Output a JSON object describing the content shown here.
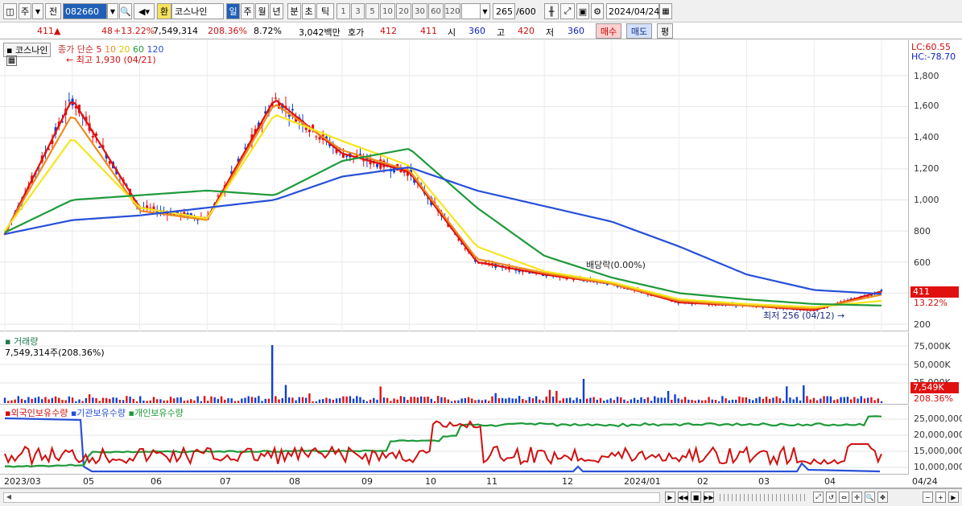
{
  "toolbar": {
    "type1": "주",
    "type2": "전",
    "code": "082660",
    "hwan": "환",
    "name": "코스나인",
    "periods": [
      "일",
      "주",
      "월",
      "년",
      "분",
      "초",
      "틱"
    ],
    "numbers": [
      "1",
      "3",
      "5",
      "10",
      "20",
      "30",
      "60",
      "120"
    ],
    "count": "265",
    "count_total": "/600",
    "date": "2024/04/24"
  },
  "quote": {
    "price": "411",
    "change": "48",
    "pct": "+13.22%",
    "volume": "7,549,314",
    "vol_pct": "208.36%",
    "turnover": "8.72%",
    "amount": "3,042백만",
    "hoga_label": "호가",
    "ask": "412",
    "bid": "411",
    "open_label": "시",
    "open": "360",
    "high_label": "고",
    "high": "420",
    "low_label": "저",
    "low": "360",
    "buy": "매수",
    "sell": "매도",
    "even": "평"
  },
  "price_panel": {
    "name": "코스나인",
    "ma_label": "종가 단순",
    "ma": [
      "5",
      "10",
      "20",
      "60",
      "120"
    ],
    "max_note": "최고 1,930 (04/21)",
    "min_note": "최저 256 (04/12)",
    "dividend_note": "배당락(0.00%)",
    "lc": "LC:60.55",
    "hc": "HC:-78.70",
    "cur_price": "411",
    "cur_pct": "13.22%",
    "yticks": [
      "1,800",
      "1,600",
      "1,400",
      "1,200",
      "1,000",
      "800",
      "600",
      "200"
    ]
  },
  "volume_panel": {
    "title": "거래량",
    "value": "7,549,314주(208.36%)",
    "yticks": [
      "75,000K",
      "50,000K",
      "25,000K"
    ],
    "cur": "7,549K",
    "cur_pct": "208.36%"
  },
  "holding_panel": {
    "legend": [
      "외국인보유수량",
      "기관보유수량",
      "개인보유수량"
    ],
    "yticks": [
      "25,000,000",
      "20,000,000",
      "15,000,000",
      "10,000,000"
    ]
  },
  "xaxis": [
    "2023/03",
    "05",
    "06",
    "07",
    "08",
    "09",
    "10",
    "11",
    "12",
    "2024/01",
    "02",
    "03",
    "04"
  ],
  "xaxis_end": "04/24",
  "colors": {
    "ma5": "#e01010",
    "ma10": "#f08a1c",
    "ma20": "#f5e61c",
    "ma60": "#1f9a3a",
    "ma120": "#2850d8",
    "up": "#e01010",
    "down": "#1040d0"
  },
  "chart_data": [
    {
      "type": "line",
      "title": "",
      "x": [
        "2023/03",
        "05",
        "06",
        "07",
        "08",
        "09",
        "10",
        "11",
        "12",
        "2024/01",
        "02",
        "03",
        "04",
        "04/24"
      ],
      "ylim": [
        150,
        2000
      ],
      "series": [
        {
          "name": "5",
          "values": [
            780,
            1650,
            950,
            880,
            1650,
            1300,
            1180,
            600,
            520,
            460,
            340,
            320,
            290,
            411
          ]
        },
        {
          "name": "10",
          "values": [
            790,
            1550,
            930,
            870,
            1620,
            1320,
            1190,
            620,
            530,
            460,
            350,
            320,
            300,
            390
          ]
        },
        {
          "name": "20",
          "values": [
            800,
            1400,
            950,
            880,
            1550,
            1380,
            1220,
            700,
            540,
            470,
            360,
            330,
            310,
            350
          ]
        },
        {
          "name": "60",
          "values": [
            790,
            1000,
            1030,
            1060,
            1030,
            1250,
            1330,
            950,
            640,
            500,
            400,
            360,
            330,
            320
          ]
        },
        {
          "name": "120",
          "values": [
            780,
            870,
            900,
            950,
            1000,
            1150,
            1210,
            1060,
            960,
            860,
            700,
            520,
            420,
            395
          ]
        }
      ]
    }
  ]
}
